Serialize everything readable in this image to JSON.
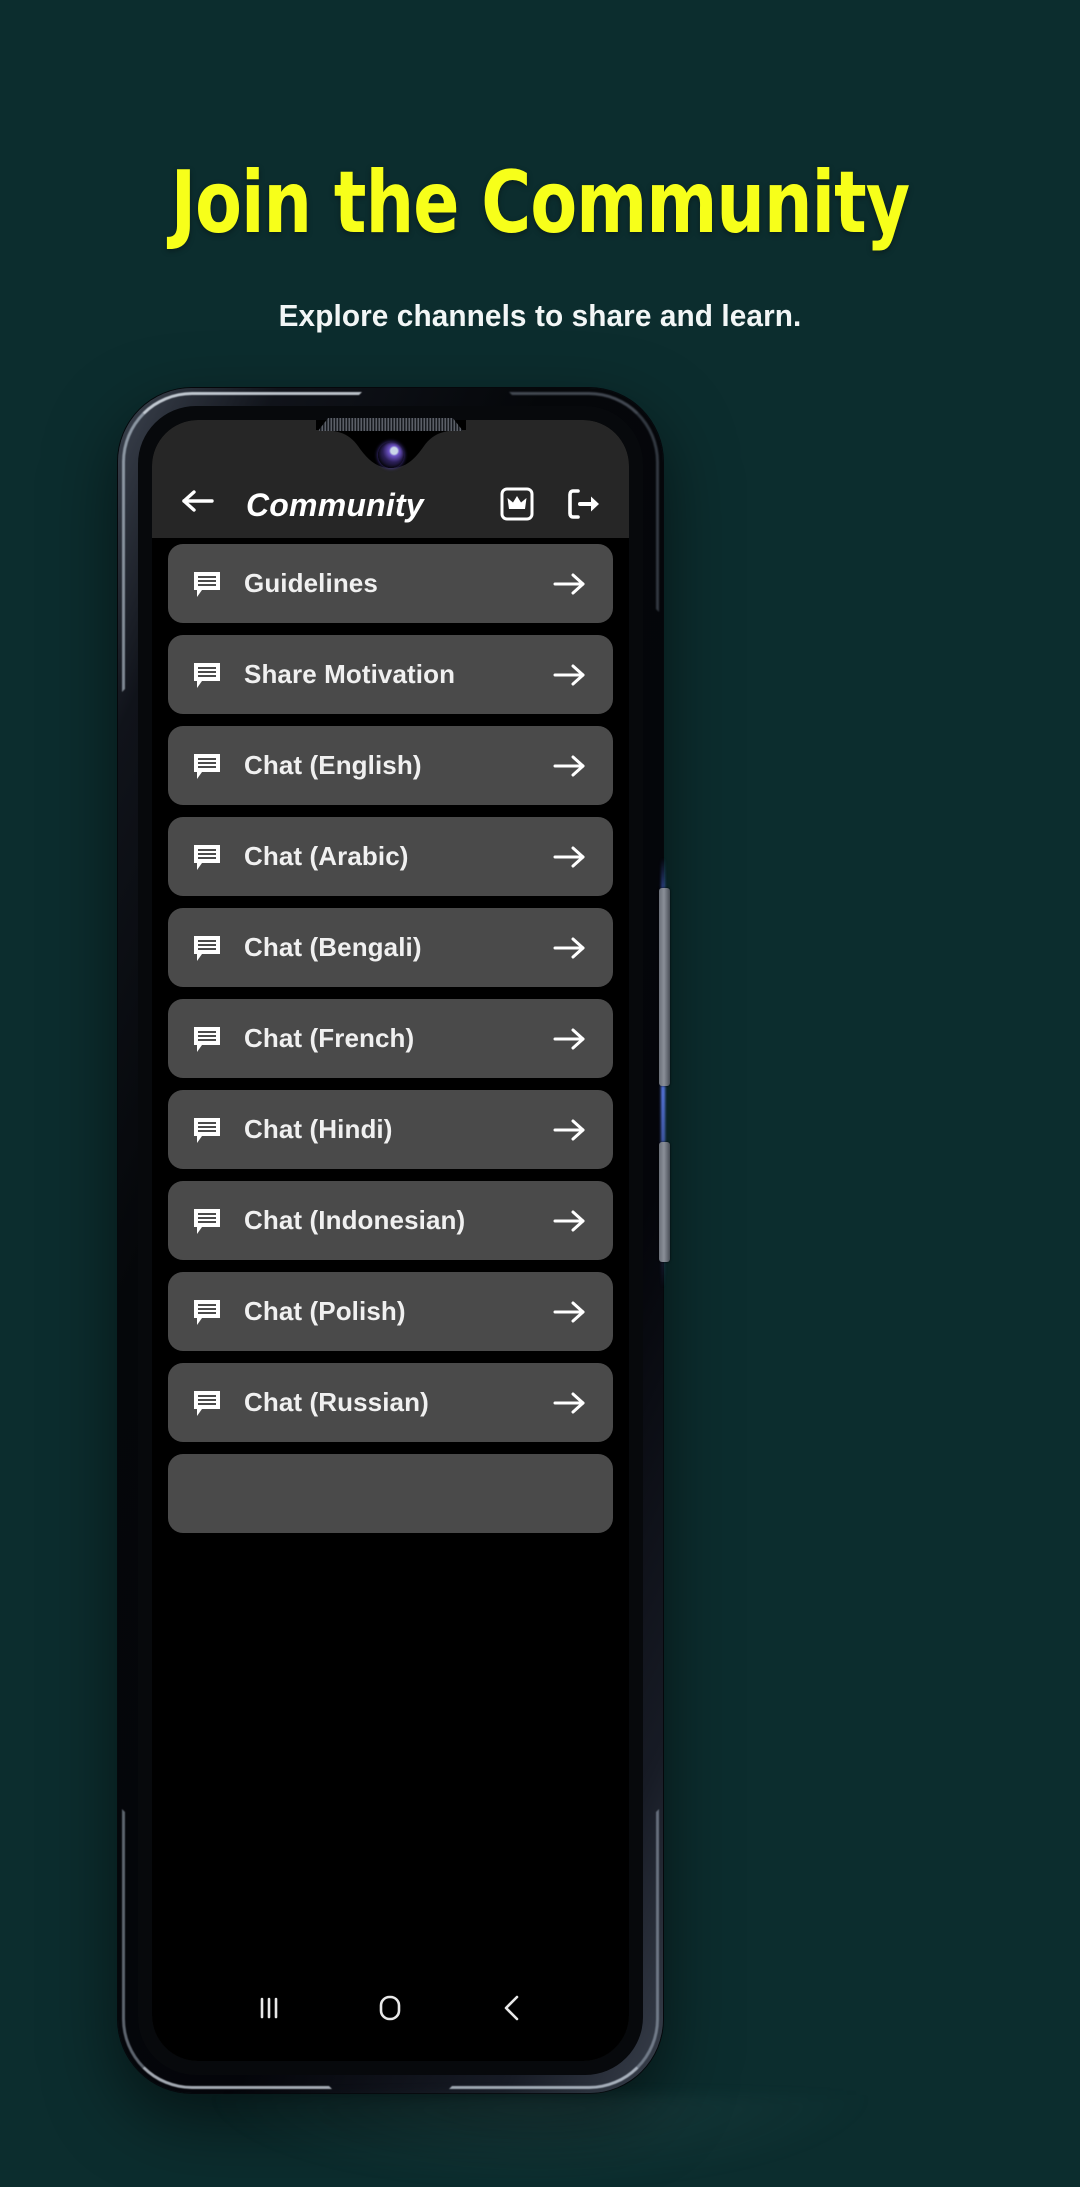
{
  "promo": {
    "title": "Join the Community",
    "subtitle": "Explore channels to share and learn.",
    "title_color": "#F7FF1A",
    "subtitle_color": "#F2F6F6",
    "background_color": "#0C2D2E"
  },
  "appbar": {
    "back_icon": "arrow-left-icon",
    "title": "Community",
    "actions": [
      {
        "name": "premium-crown-button",
        "icon": "crown-boxed-icon"
      },
      {
        "name": "logout-button",
        "icon": "logout-icon"
      }
    ]
  },
  "list": {
    "row_icon": "chat-bubble-lines-icon",
    "row_arrow": "arrow-right-icon",
    "items": [
      {
        "label": "Guidelines"
      },
      {
        "label": "Share Motivation"
      },
      {
        "label": "Chat (English)"
      },
      {
        "label": "Chat (Arabic)"
      },
      {
        "label": "Chat (Bengali)"
      },
      {
        "label": "Chat (French)"
      },
      {
        "label": "Chat (Hindi)"
      },
      {
        "label": "Chat (Indonesian)"
      },
      {
        "label": "Chat (Polish)"
      },
      {
        "label": "Chat (Russian)"
      },
      {
        "label": ""
      }
    ]
  },
  "navbar": {
    "recents_icon": "recents-icon",
    "home_icon": "home-icon",
    "back_icon": "back-chevron-icon"
  },
  "device": {
    "earpiece": "earpiece-grille",
    "camera": "front-camera",
    "volume_button": "volume-rocker",
    "power_button": "power-button"
  }
}
